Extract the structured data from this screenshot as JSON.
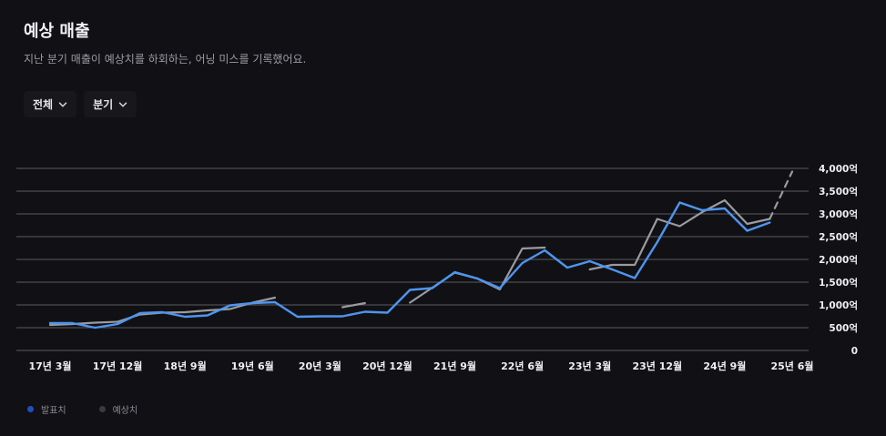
{
  "header": {
    "title": "예상 매출",
    "subtitle": "지난 분기 매출이 예상치를 하회하는, 어닝 미스를 기록했어요."
  },
  "filters": [
    {
      "label": "전체",
      "icon": "chevron-down-icon"
    },
    {
      "label": "분기",
      "icon": "chevron-down-icon"
    }
  ],
  "colors": {
    "background": "#111115",
    "actual": "#4e95f0",
    "estimate": "#9a9aa0",
    "grid": "#5a5a60",
    "legend_actual_dot": "#1f4fc0",
    "legend_estimate_dot": "#3a3a40"
  },
  "legend": [
    {
      "label": "발표치"
    },
    {
      "label": "예상치"
    }
  ],
  "chart_data": {
    "type": "line",
    "x_tick_labels": [
      "17년 3월",
      "17년 12월",
      "18년 9월",
      "19년 6월",
      "20년 3월",
      "20년 12월",
      "21년 9월",
      "22년 6월",
      "23년 3월",
      "23년 12월",
      "24년 9월",
      "25년 6월"
    ],
    "y_tick_labels": [
      "4,000억",
      "3,500억",
      "3,000억",
      "2,500억",
      "2,000억",
      "1,500억",
      "1,000억",
      "500억",
      "0"
    ],
    "ylim": [
      0,
      4000
    ],
    "y_unit": "억",
    "x_range": [
      0,
      33
    ],
    "grid": true,
    "legend_position": "bottom-left",
    "series": [
      {
        "name": "발표치",
        "style": "solid",
        "points": [
          [
            0,
            600
          ],
          [
            1,
            600
          ],
          [
            2,
            500
          ],
          [
            3,
            580
          ],
          [
            4,
            820
          ],
          [
            5,
            840
          ],
          [
            6,
            740
          ],
          [
            7,
            770
          ],
          [
            8,
            990
          ],
          [
            9,
            1040
          ],
          [
            10,
            1060
          ],
          [
            11,
            740
          ],
          [
            12,
            750
          ],
          [
            13,
            750
          ],
          [
            14,
            850
          ],
          [
            15,
            830
          ],
          [
            16,
            1330
          ],
          [
            17,
            1370
          ],
          [
            18,
            1720
          ],
          [
            19,
            1580
          ],
          [
            20,
            1370
          ],
          [
            21,
            1920
          ],
          [
            22,
            2200
          ],
          [
            23,
            1820
          ],
          [
            24,
            1960
          ],
          [
            25,
            1780
          ],
          [
            26,
            1590
          ],
          [
            27,
            2380
          ],
          [
            28,
            3250
          ],
          [
            29,
            3080
          ],
          [
            30,
            3120
          ],
          [
            31,
            2630
          ],
          [
            32,
            2810
          ]
        ]
      },
      {
        "name": "예상치",
        "style": "solid",
        "segments": [
          [
            [
              0,
              560
            ],
            [
              1,
              580
            ],
            [
              2,
              610
            ],
            [
              3,
              630
            ],
            [
              4,
              790
            ],
            [
              5,
              830
            ],
            [
              6,
              840
            ],
            [
              7,
              880
            ],
            [
              8,
              910
            ],
            [
              9,
              1050
            ],
            [
              10,
              1160
            ]
          ],
          [
            [
              13,
              950
            ],
            [
              14,
              1040
            ]
          ],
          [
            [
              16,
              1050
            ],
            [
              17,
              1380
            ],
            [
              18,
              1710
            ],
            [
              19,
              1580
            ],
            [
              20,
              1340
            ],
            [
              21,
              2240
            ],
            [
              22,
              2260
            ]
          ],
          [
            [
              24,
              1780
            ],
            [
              25,
              1880
            ],
            [
              26,
              1880
            ],
            [
              27,
              2890
            ],
            [
              28,
              2730
            ],
            [
              29,
              3040
            ],
            [
              30,
              3300
            ],
            [
              31,
              2780
            ],
            [
              32,
              2890
            ]
          ]
        ],
        "forecast": [
          [
            32,
            2890
          ],
          [
            33,
            3930
          ]
        ]
      }
    ]
  }
}
